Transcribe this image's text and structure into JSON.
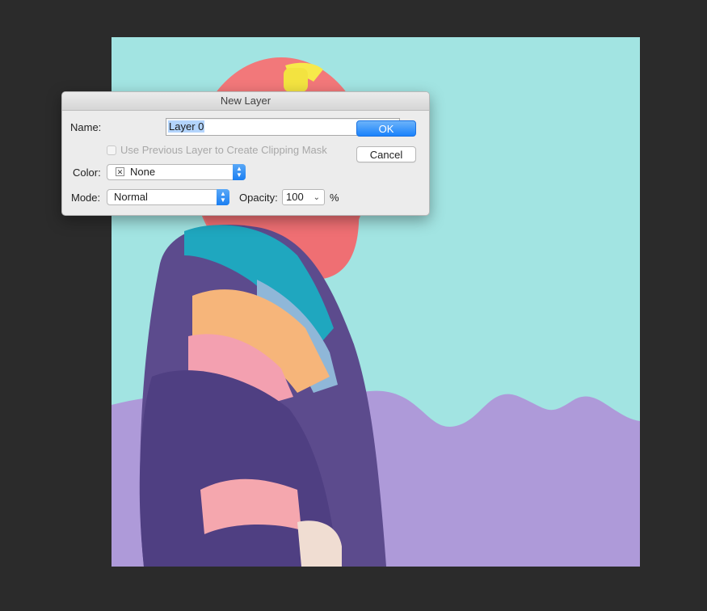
{
  "dialog": {
    "title": "New Layer",
    "name_label": "Name:",
    "name_value": "Layer 0",
    "ok_label": "OK",
    "cancel_label": "Cancel",
    "clipping_label": "Use Previous Layer to Create Clipping Mask",
    "color_label": "Color:",
    "color_value": "None",
    "mode_label": "Mode:",
    "mode_value": "Normal",
    "opacity_label": "Opacity:",
    "opacity_value": "100",
    "opacity_unit": "%"
  },
  "colors": {
    "workspace": "#2b2b2b",
    "canvas_top": "#a2e4e2",
    "canvas_bottom": "#ae9ad9",
    "accent": "#1a82fb"
  },
  "icons": {
    "color_swatch": "none-swatch-icon",
    "select_arrows": "up-down-chevron-icon",
    "opacity_dropdown": "chevron-down-icon"
  }
}
